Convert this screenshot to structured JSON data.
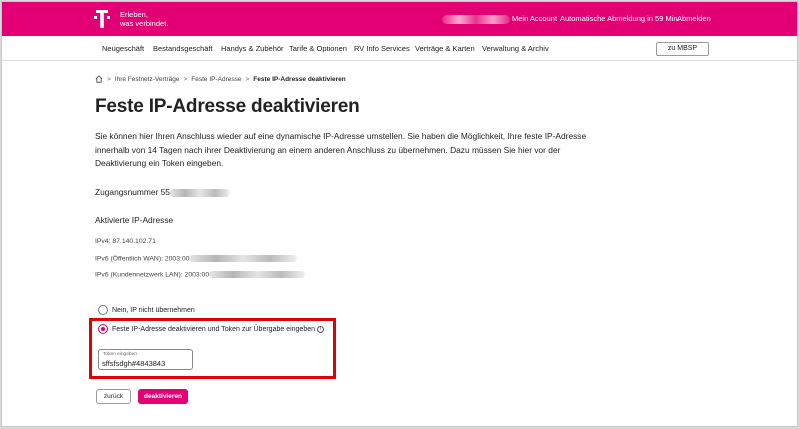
{
  "brand": {
    "claim_line1": "Erleben,",
    "claim_line2": "was verbindet.",
    "color": "#e20074",
    "logo_icon": "telekom-t-logo"
  },
  "header": {
    "account_label": "Mein Account",
    "auto_logout": "Automatische Abmeldung in 59 Min.",
    "logout_label": "Abmelden"
  },
  "nav": {
    "items": [
      {
        "label": "Neugeschäft"
      },
      {
        "label": "Bestandsgeschäft"
      },
      {
        "label": "Handys & Zubehör"
      },
      {
        "label": "Tarife & Optionen"
      },
      {
        "label": "RV Info Services"
      },
      {
        "label": "Verträge & Karten"
      },
      {
        "label": "Verwaltung & Archiv"
      }
    ],
    "mbsp_button": "zu MBSP"
  },
  "breadcrumb": {
    "home_icon": "home-icon",
    "items": [
      "Ihre Festnetz-Verträge",
      "Feste IP-Adresse"
    ],
    "current": "Feste IP-Adresse deaktivieren",
    "separator": ">"
  },
  "page": {
    "title": "Feste IP-Adresse deaktivieren",
    "intro": "Sie können hier Ihren Anschluss wieder auf eine dynamische IP-Adresse umstellen. Sie haben die Möglichkeit, Ihre feste IP-Adresse innerhalb von 14 Tagen nach ihrer Deaktivierung an einem anderen Anschluss zu übernehmen. Dazu müssen Sie hier vor der Deaktivierung ein Token eingeben.",
    "access_label": "Zugangsnummer",
    "access_value": "55",
    "active_ip_heading": "Aktivierte IP-Adresse",
    "ipv4": "IPv4: 87.140.102.71",
    "ipv6_wan": "IPv6 (Öffentlich WAN): 2003:00",
    "ipv6_lan": "IPv6 (Kundennetzwerk LAN): 2003:00"
  },
  "options": {
    "option_no": "Nein, IP nicht übernehmen",
    "option_yes": "Feste IP-Adresse deaktivieren und Token zur Übergabe eingeben",
    "selected": "option_yes",
    "info_icon": "info-icon"
  },
  "token": {
    "label": "Token eingeben",
    "value": "sffsfsdgh#4843843"
  },
  "buttons": {
    "back": "zurück",
    "deactivate": "deaktivieren"
  },
  "highlight": {
    "color": "#e00000"
  }
}
